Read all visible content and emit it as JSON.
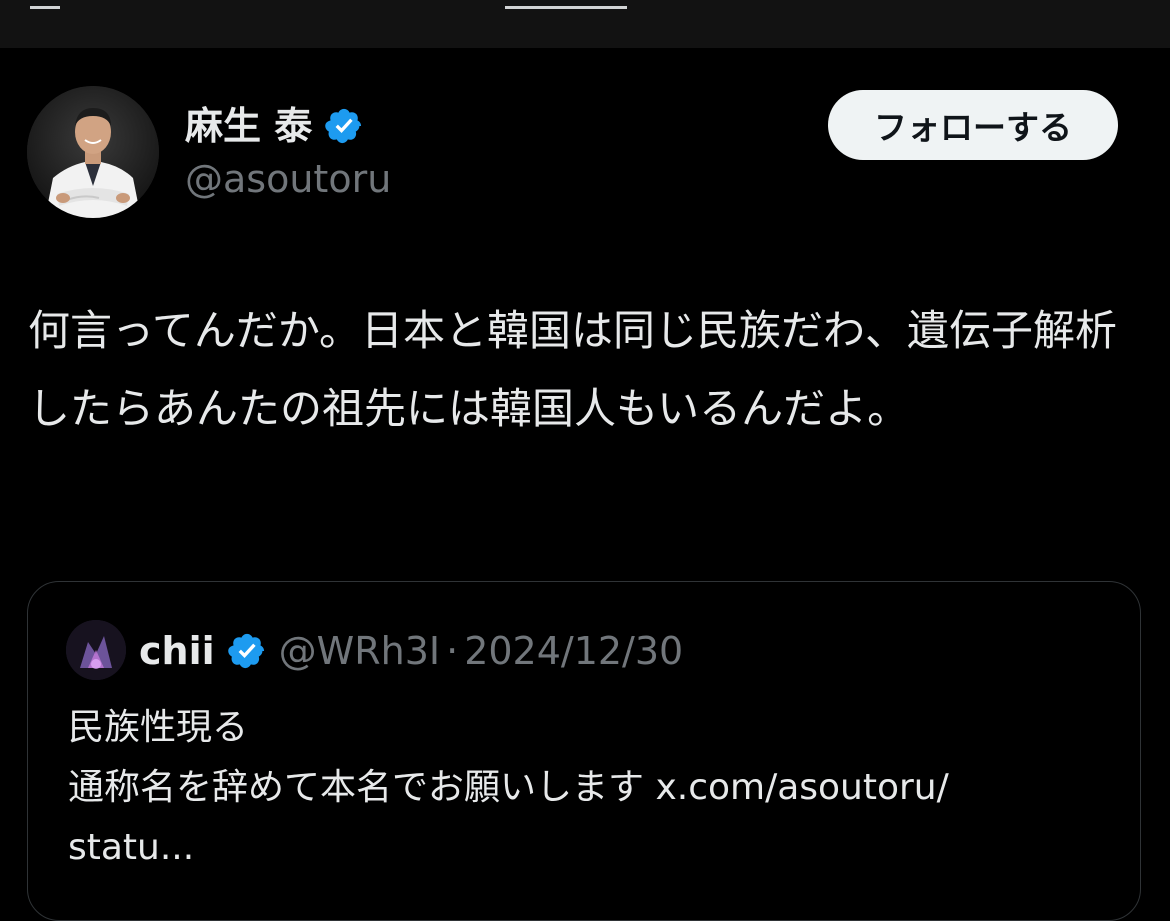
{
  "author": {
    "display_name": "麻生 泰",
    "handle": "@asoutoru",
    "verified_icon": "verified-badge-icon"
  },
  "follow_button": {
    "label": "フォローする"
  },
  "post": {
    "text": "何言ってんだか。日本と韓国は同じ民族だわ、遺伝子解析したらあんたの祖先には韓国人もいるんだよ。"
  },
  "quoted_post": {
    "display_name": "chii",
    "handle": "@WRh3I",
    "separator": "·",
    "date": "2024/12/30",
    "text_line1": "民族性現る",
    "text_line2": "通称名を辞めて本名でお願いします x.com/asoutoru/",
    "text_line3": "statu..."
  },
  "colors": {
    "background": "#000000",
    "text_primary": "#e7e9ea",
    "text_secondary": "#71767b",
    "verified_blue": "#1d9bf0",
    "button_bg": "#eff3f4",
    "border": "#2f3336"
  }
}
